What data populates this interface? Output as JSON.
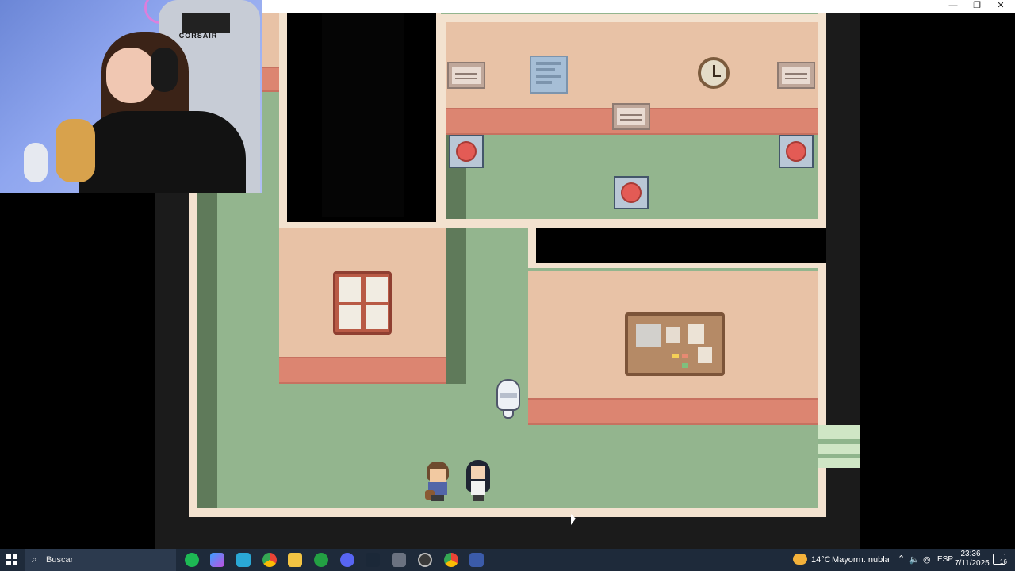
{
  "window": {
    "controls": [
      "—",
      "❐",
      "✕"
    ]
  },
  "webcam": {
    "chair_brand": "CORSAIR"
  },
  "game": {
    "icons": {
      "clock": "clock-icon",
      "corkboard": "corkboard-icon",
      "window": "window-icon",
      "red_button": "red-button-icon"
    },
    "colors": {
      "floor": "#93b58e",
      "wall": "#e8c2a6",
      "band": "#dc8571",
      "trim": "#f3e2cf"
    }
  },
  "taskbar": {
    "search_placeholder": "Buscar",
    "weather_temp": "14°C",
    "weather_text": "Mayorm. nubla...",
    "language": "ESP",
    "time": "23:36",
    "date": "7/11/2025",
    "notification_count": "16",
    "apps": [
      "spotify",
      "copilot",
      "app-blue",
      "chrome",
      "file-explorer",
      "xbox",
      "discord",
      "steam",
      "app-gray",
      "obs",
      "chrome-alt",
      "app-game"
    ]
  }
}
